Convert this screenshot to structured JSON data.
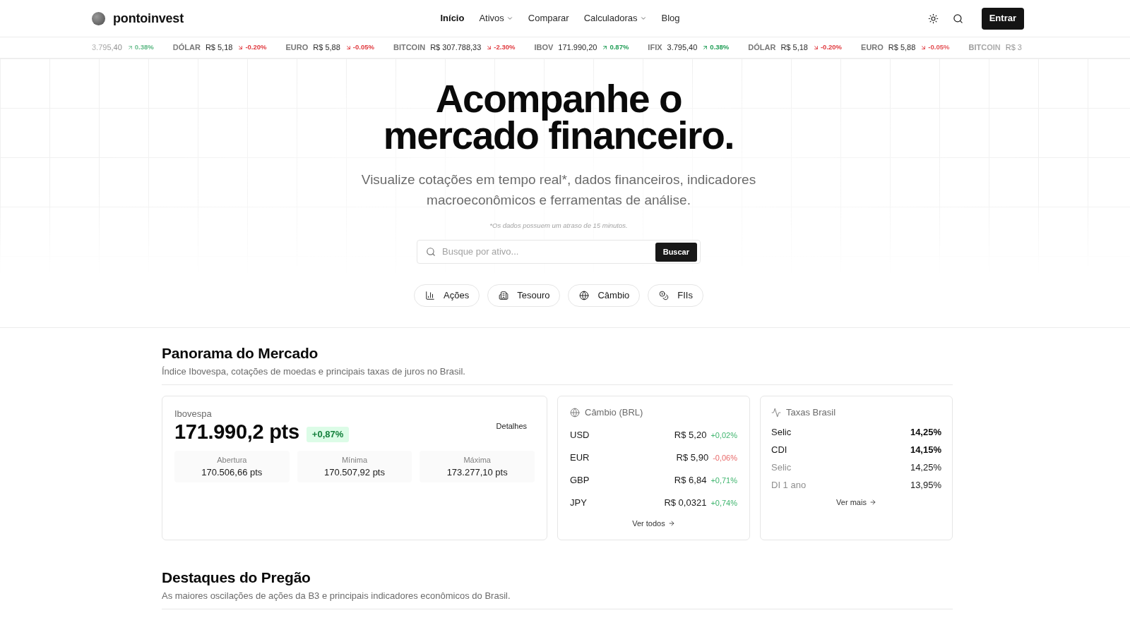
{
  "header": {
    "brand": "pontoinvest",
    "nav": [
      {
        "label": "Início",
        "selected": true,
        "dropdown": false
      },
      {
        "label": "Ativos",
        "selected": false,
        "dropdown": true
      },
      {
        "label": "Comparar",
        "selected": false,
        "dropdown": false
      },
      {
        "label": "Calculadoras",
        "selected": false,
        "dropdown": true
      },
      {
        "label": "Blog",
        "selected": false,
        "dropdown": false
      }
    ],
    "login_button": "Entrar"
  },
  "ticker": [
    {
      "value": "3.795,40",
      "change": "0.38%",
      "up": true
    },
    {
      "label": "DÓLAR",
      "value": "R$ 5,18",
      "change": "-0.20%",
      "up": false
    },
    {
      "label": "EURO",
      "value": "R$ 5,88",
      "change": "-0.05%",
      "up": false
    },
    {
      "label": "BITCOIN",
      "value": "R$ 307.788,33",
      "change": "-2.30%",
      "up": false
    },
    {
      "label": "IBOV",
      "value": "171.990,20",
      "change": "0.87%",
      "up": true
    },
    {
      "label": "IFIX",
      "value": "3.795,40",
      "change": "0.38%",
      "up": true
    },
    {
      "label": "DÓLAR",
      "value": "R$ 5,18",
      "change": "-0.20%",
      "up": false
    },
    {
      "label": "EURO",
      "value": "R$ 5,88",
      "change": "-0.05%",
      "up": false
    },
    {
      "label": "BITCOIN",
      "value": "R$ 3"
    }
  ],
  "hero": {
    "title_lines": [
      "Acompanhe o",
      "mercado financeiro."
    ],
    "subtitle": "Visualize cotações em tempo real*, dados financeiros, indicadores macroeconômicos e ferramentas de análise.",
    "note": "*Os dados possuem um atraso de 15 minutos.",
    "search": {
      "placeholder": "Busque por ativo...",
      "button": "Buscar"
    },
    "categories": [
      {
        "label": "Ações"
      },
      {
        "label": "Tesouro"
      },
      {
        "label": "Câmbio"
      },
      {
        "label": "FIIs"
      }
    ]
  },
  "panorama": {
    "title": "Panorama do Mercado",
    "subtitle": "Índice Ibovespa, cotações de moedas e principais taxas de juros no Brasil.",
    "ibovespa": {
      "label": "Ibovespa",
      "value": "171.990,2 pts",
      "change": "+0,87%",
      "up": true,
      "details_button": "Detalhes",
      "stats": [
        {
          "label": "Abertura",
          "value": "170.506,66 pts"
        },
        {
          "label": "Mínima",
          "value": "170.507,92 pts"
        },
        {
          "label": "Máxima",
          "value": "173.277,10 pts"
        }
      ]
    },
    "cambio": {
      "title": "Câmbio (BRL)",
      "rows": [
        {
          "code": "USD",
          "value": "R$ 5,20",
          "change": "+0,02%",
          "up": true
        },
        {
          "code": "EUR",
          "value": "R$ 5,90",
          "change": "-0,06%",
          "up": false
        },
        {
          "code": "GBP",
          "value": "R$ 6,84",
          "change": "+0,71%",
          "up": true
        },
        {
          "code": "JPY",
          "value": "R$ 0,0321",
          "change": "+0,74%",
          "up": true
        }
      ],
      "link": "Ver todos"
    },
    "taxas": {
      "title": "Taxas Brasil",
      "rows": [
        {
          "label": "Selic",
          "value": "14,25%",
          "highlighted": true
        },
        {
          "label": "CDI",
          "value": "14,15%",
          "highlighted": true
        },
        {
          "label": "Selic",
          "value": "14,25%",
          "highlighted": false
        },
        {
          "label": "DI 1 ano",
          "value": "13,95%",
          "highlighted": false
        }
      ],
      "link": "Ver mais"
    }
  },
  "destaques": {
    "title": "Destaques do Pregão",
    "subtitle": "As maiores oscilações de ações da B3 e principais indicadores econômicos do Brasil."
  }
}
